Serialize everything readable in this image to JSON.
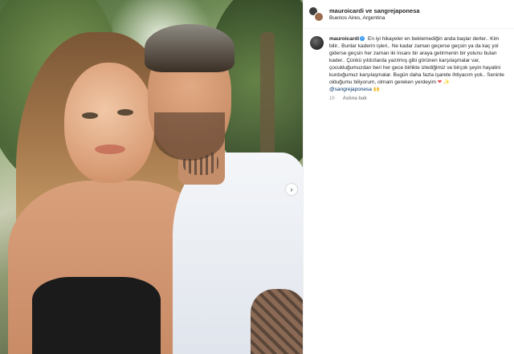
{
  "header": {
    "owner": "mauroicardi ve sangrejaponesa",
    "location": "Buenos Aires, Argentina"
  },
  "media": {
    "next_icon": "chevron-right-icon",
    "next_glyph": "›"
  },
  "caption": {
    "username": "mauroicardi",
    "verified_glyph": "✓",
    "text": "En iyi hikayeler en beklemediğin anda başlar derler.. Kim bilir.. Bunlar kaderin işleri.. Ne kadar zaman geçerse geçsin ya da kaç yol giderse geçsin her zaman iki insanı bir araya getirmenin bir yolunu bulan kader.. Çünkü yıldızlarda yazılmış gibi görünen karşılaşmalar var, çocukluğumuzdan beri her gece birlikte izlediğimiz ve birçok şeyin hayalini kurduğumuz karşılaşmalar. Bugün daha fazla işarete ihtiyacım yok.. Seninle olduğumu biliyorum, olmam gereken yerdeyim",
    "emoji_heart": "❤",
    "emoji_sparkle": "✨",
    "mention": "@sangrejaponesa",
    "emoji_hands": "🙌",
    "time": "1h",
    "reply_label": "Aslına bak"
  },
  "colors": {
    "accent": "#3897f0",
    "mention": "#00376b",
    "heart": "#ed4956",
    "muted": "#8e8e8e"
  }
}
